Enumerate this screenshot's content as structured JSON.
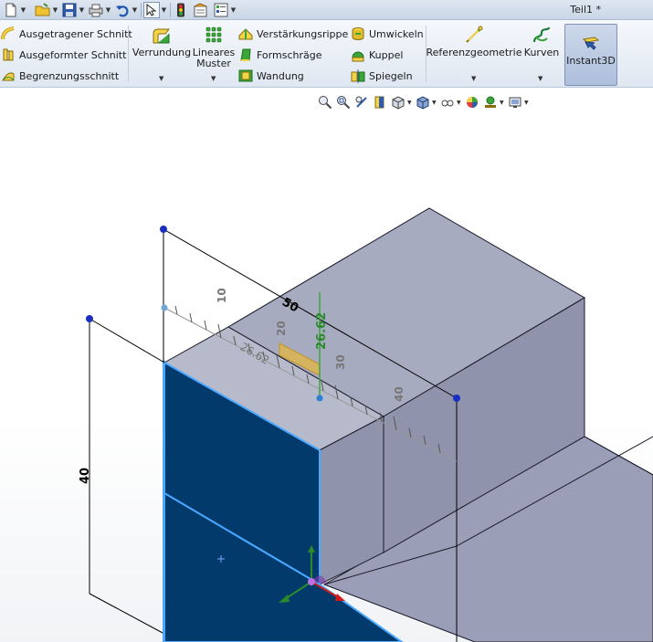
{
  "document": {
    "title": "Teil1 *"
  },
  "quick_access": {
    "buttons": [
      "new-document-icon",
      "open-folder-icon",
      "save-icon",
      "print-icon",
      "undo-icon",
      "select-pointer-icon",
      "rebuild-traffic-light-icon",
      "file-properties-icon",
      "options-icon"
    ]
  },
  "ribbon": {
    "col1": [
      "Ausgetragener Schnitt",
      "Ausgeformter Schnitt",
      "Begrenzungsschnitt"
    ],
    "verrundung": "Verrundung",
    "lineares_muster": [
      "Lineares",
      "Muster"
    ],
    "col3": [
      "Verstärkungsrippe",
      "Formschräge",
      "Wandung"
    ],
    "col4": [
      "Umwickeln",
      "Kuppel",
      "Spiegeln"
    ],
    "referenzgeometrie": "Referenzgeometrie",
    "kurven": "Kurven",
    "instant3d": "Instant3D"
  },
  "view_toolbar": {
    "icons": [
      "zoom-to-fit-icon",
      "zoom-to-area-icon",
      "previous-view-icon",
      "section-view-icon",
      "view-orientation-icon",
      "display-style-icon",
      "hide-show-items-icon",
      "edit-appearance-icon",
      "apply-scene-icon",
      "view-settings-icon"
    ]
  },
  "model": {
    "dimension_top": "50",
    "dimension_side": "40",
    "ruler_value": "26.62",
    "ruler_ghost": "26.62",
    "ruler_ticks": [
      "10",
      "20",
      "30",
      "40"
    ],
    "accent_face": "#013a6b",
    "body_color": "#9a9eb6"
  }
}
